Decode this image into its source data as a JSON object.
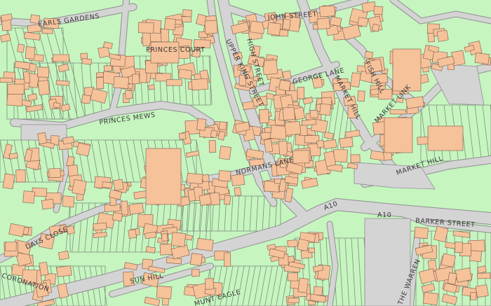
{
  "map": {
    "colors": {
      "land": "#c6f5c0",
      "building": "#f6c29a",
      "building_stroke": "#8a6a55",
      "road": "#d4d4d4",
      "road_edge": "#8f8f8f",
      "parcel_line": "#7e8f7c",
      "text": "#3a3a3a"
    },
    "labels": {
      "earls_gardens": "EARLS GARDENS",
      "princes_court": "PRINCES COURT",
      "john_street": "JOHN STREET",
      "upper_king_street": "UPPER KING STREET",
      "high_street": "HIGH STREET",
      "george_lane": "GEORGE LANE",
      "market_hill_1": "MARKET HILL",
      "fish_hill": "FISH HILL",
      "market_link": "MARKET LINK",
      "princes_mews": "PRINCES MEWS",
      "normans_lane": "NORMANS LANE",
      "market_hill_2": "MARKET HILL",
      "a10_1": "A10",
      "a10_2": "A10",
      "barkers_street": "BARKER STREET",
      "days_close": "DAYS CLOSE",
      "sun_hill": "SUN HILL",
      "coronation": "CORONATION",
      "the_warren": "THE WARREN",
      "munt_eagle": "MUNT EAGLE"
    }
  }
}
